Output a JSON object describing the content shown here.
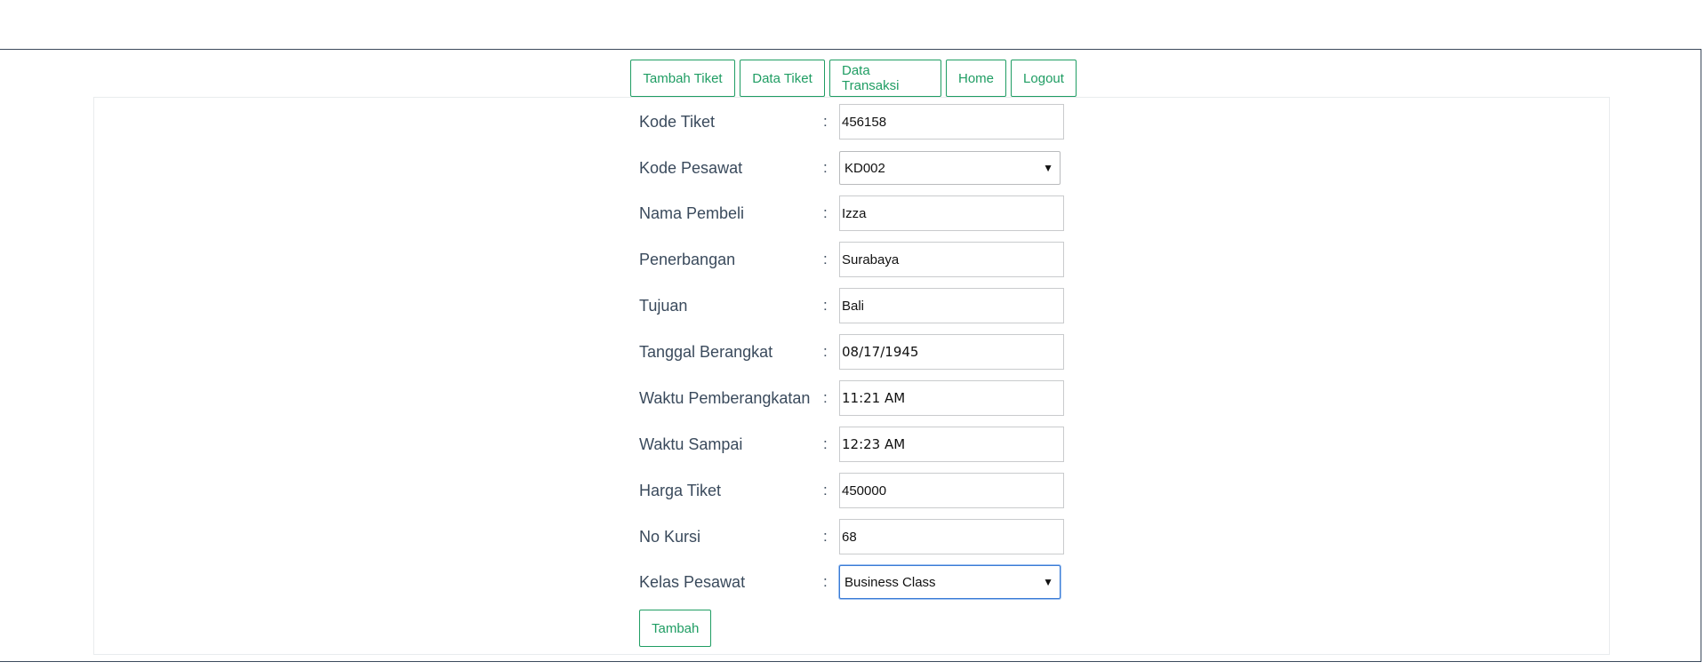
{
  "nav": {
    "items": [
      "Tambah Tiket",
      "Data Tiket",
      "Data Transaksi",
      "Home",
      "Logout"
    ]
  },
  "form": {
    "fields": [
      {
        "label": "Kode Tiket",
        "value": "456158"
      },
      {
        "label": "Kode Pesawat",
        "value": "KD002"
      },
      {
        "label": "Nama Pembeli",
        "value": "Izza"
      },
      {
        "label": "Penerbangan",
        "value": "Surabaya"
      },
      {
        "label": "Tujuan",
        "value": "Bali"
      },
      {
        "label": "Tanggal Berangkat",
        "value": "08/17/1945"
      },
      {
        "label": "Waktu Pemberangkatan",
        "value": "11:21 AM"
      },
      {
        "label": "Waktu Sampai",
        "value": "12:23 AM"
      },
      {
        "label": "Harga Tiket",
        "value": "450000"
      },
      {
        "label": "No Kursi",
        "value": "68"
      },
      {
        "label": "Kelas Pesawat",
        "value": "Business Class"
      }
    ],
    "separator": ":",
    "dropdown_arrow": "▼",
    "submit_label": "Tambah"
  },
  "colors": {
    "accent": "#1f9d63",
    "frame": "#3c4a5c",
    "focus": "#3a7bd5"
  }
}
